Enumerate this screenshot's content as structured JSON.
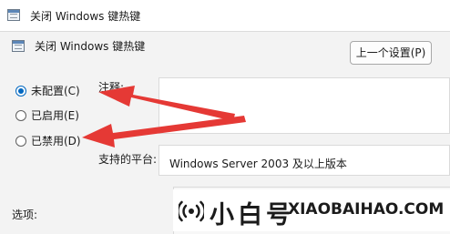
{
  "window": {
    "title": "关闭 Windows 键热键"
  },
  "dialog": {
    "heading": "关闭 Windows 键热键",
    "prev_button": "上一个设置(P)"
  },
  "radios": [
    {
      "label": "未配置(C)",
      "checked": true
    },
    {
      "label": "已启用(E)",
      "checked": false
    },
    {
      "label": "已禁用(D)",
      "checked": false
    }
  ],
  "comment": {
    "label": "注释:"
  },
  "platform": {
    "label": "支持的平台:",
    "value": "Windows Server 2003 及以上版本"
  },
  "options": {
    "label": "选项:"
  },
  "watermark": {
    "text_cn": "小白号",
    "text_en": "XIAOBAIHAO.COM"
  },
  "colors": {
    "accent": "#0067c0",
    "arrow": "#e53935"
  }
}
